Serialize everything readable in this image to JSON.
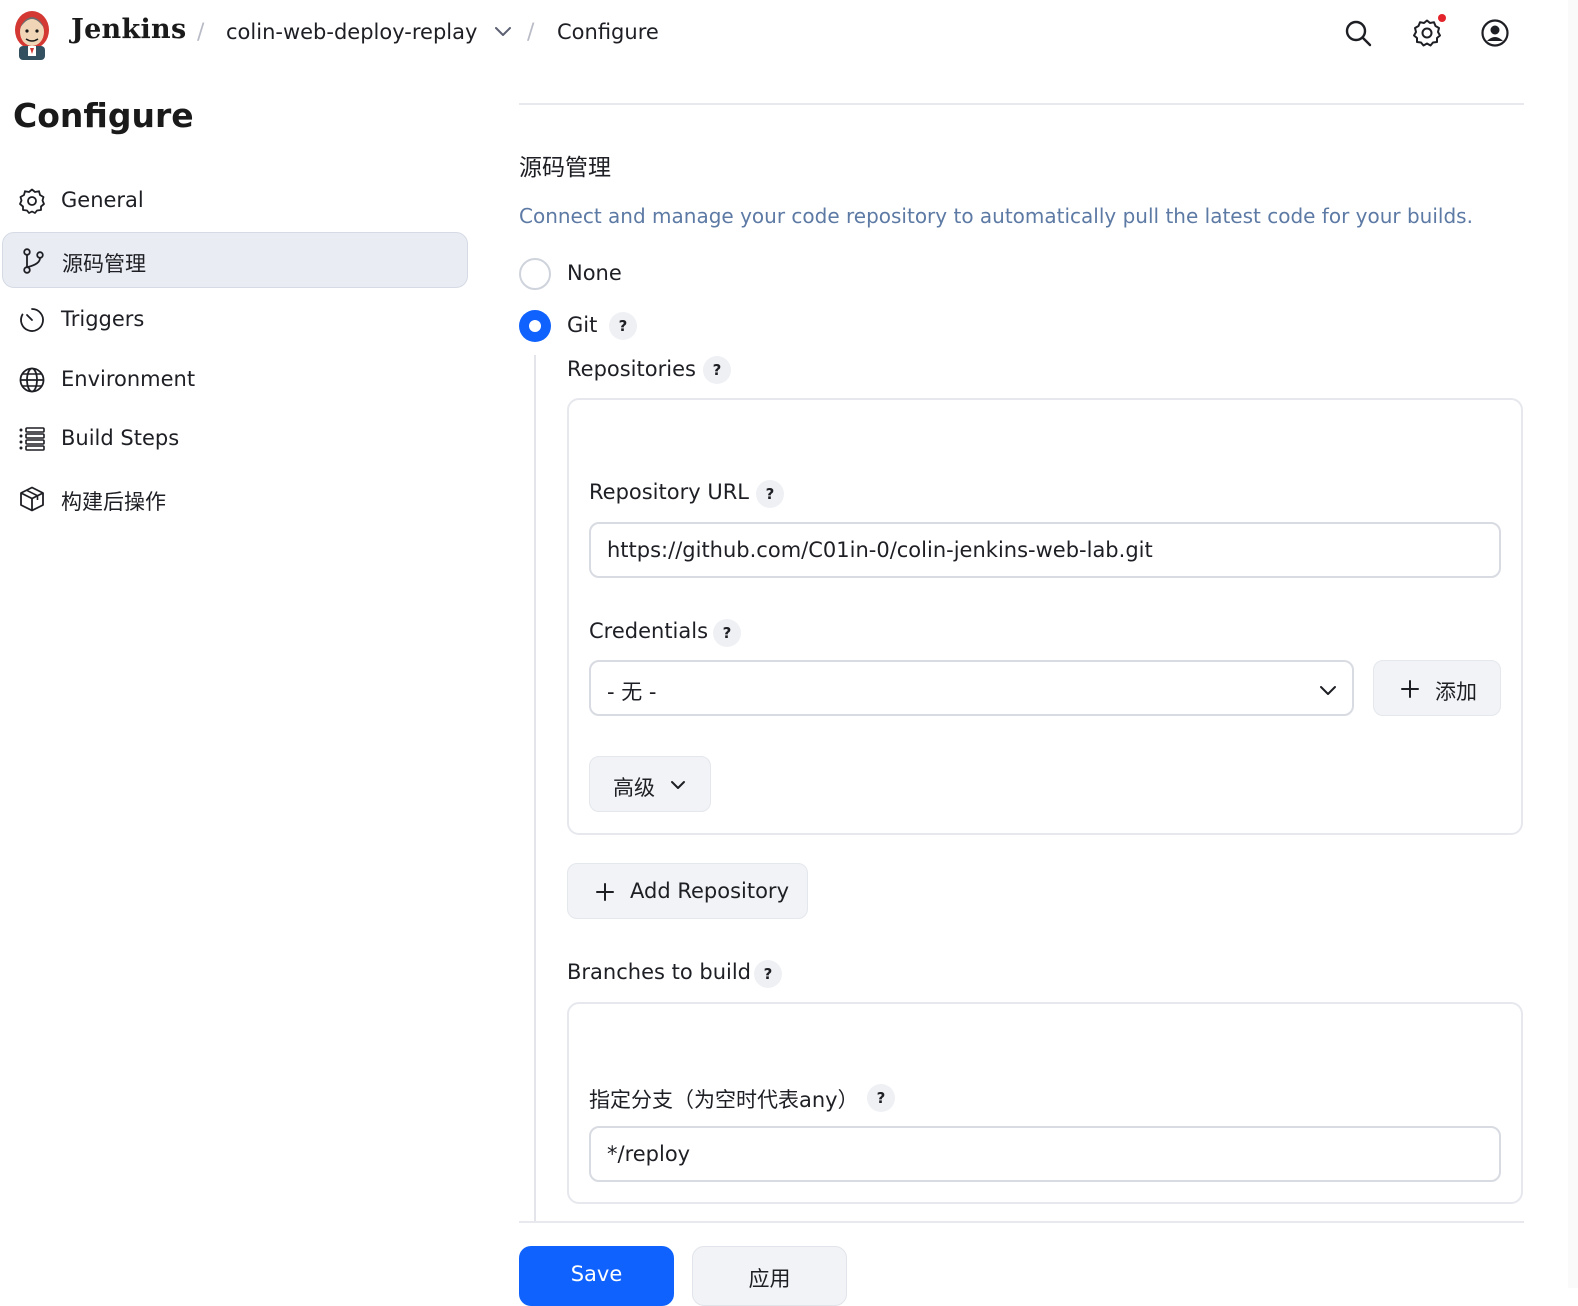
{
  "header": {
    "brand": "Jenkins",
    "breadcrumb": [
      "colin-web-deploy-replay",
      "Configure"
    ],
    "icons": [
      "search-icon",
      "gear-icon",
      "user-icon"
    ],
    "notification_color": "#e3242b"
  },
  "sidebar": {
    "title": "Configure",
    "items": [
      {
        "label": "General",
        "icon": "gear-icon"
      },
      {
        "label": "源码管理",
        "icon": "git-branch-icon",
        "active": true
      },
      {
        "label": "Triggers",
        "icon": "clock-icon"
      },
      {
        "label": "Environment",
        "icon": "globe-icon"
      },
      {
        "label": "Build Steps",
        "icon": "list-icon"
      },
      {
        "label": "构建后操作",
        "icon": "package-icon"
      }
    ]
  },
  "scm": {
    "title": "源码管理",
    "description": "Connect and manage your code repository to automatically pull the latest code for your builds.",
    "options": [
      {
        "label": "None",
        "selected": false
      },
      {
        "label": "Git",
        "selected": true
      }
    ],
    "help": "?",
    "repositories": {
      "label": "Repositories",
      "url_label": "Repository URL",
      "url_value": "https://github.com/C01in-0/colin-jenkins-web-lab.git",
      "credentials_label": "Credentials",
      "credentials_value": "- 无 -",
      "add_button": "添加",
      "advanced_button": "高级",
      "add_repository_button": "Add Repository"
    },
    "branches": {
      "label": "Branches to build",
      "spec_label": "指定分支（为空时代表any）",
      "spec_value": "*/reploy"
    }
  },
  "actions": {
    "save": "Save",
    "apply": "应用"
  },
  "colors": {
    "accent": "#0f62fe",
    "description": "#5d7aa5"
  }
}
